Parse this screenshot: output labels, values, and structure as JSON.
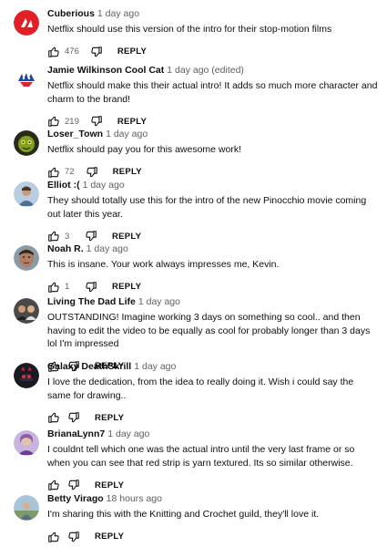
{
  "comments": [
    {
      "author": "Cuberious",
      "time": "1 day ago",
      "text": "Netflix should use this version of the intro for their stop-motion films",
      "likes": "476",
      "reply": "REPLY",
      "avatar_icon": "cuberious-logo-avatar",
      "accent": "#e01f26"
    },
    {
      "author": "Jamie Wilkinson Cool Cat",
      "time": "1 day ago (edited)",
      "text": "Netflix should make this their actual intro! It adds so much more character and charm to the brand!",
      "likes": "219",
      "reply": "REPLY",
      "avatar_icon": "cat-drawing-avatar",
      "accent": "#2244aa"
    },
    {
      "author": "Loser_Town",
      "time": "1 day ago",
      "text": "Netflix should pay you for this awesome work!",
      "likes": "72",
      "reply": "REPLY",
      "avatar_icon": "green-character-avatar",
      "accent": "#6a8a1a"
    },
    {
      "author": "Elliot :(",
      "time": "1 day ago",
      "text": "They should totally use this for the intro of the new Pinocchio movie coming out later this year.",
      "likes": "3",
      "reply": "REPLY",
      "avatar_icon": "person-photo-avatar",
      "accent": "#6b8cae"
    },
    {
      "author": "Noah R.",
      "time": "1 day ago",
      "text": "This is insane. Your work always impresses me, Kevin.",
      "likes": "1",
      "reply": "REPLY",
      "avatar_icon": "face-photo-avatar",
      "accent": "#7a5a48"
    },
    {
      "author": "Living The Dad Life",
      "time": "1 day ago",
      "text": "OUTSTANDING! Imagine working 3 days on something so cool.. and then having to edit the video to be equally as cool for probably longer than 3 days lol I'm impressed",
      "likes": "",
      "reply": "REPLY",
      "avatar_icon": "group-photo-avatar",
      "accent": "#3a3a3a"
    },
    {
      "author": "Galaxy DeathSkrill",
      "time": "1 day ago",
      "text": "I love the dedication, from the idea to really doing it. Wish i could say the same for drawing..",
      "likes": "",
      "reply": "REPLY",
      "avatar_icon": "dark-character-avatar",
      "accent": "#c8263a"
    },
    {
      "author": "BrianaLynn7",
      "time": "1 day ago",
      "text": "I couldnt tell which one was the actual intro until the very last frame or so when you can see that red strip is yarn textured. Its so similar otherwise.",
      "likes": "",
      "reply": "REPLY",
      "avatar_icon": "purple-portrait-avatar",
      "accent": "#9a6ab8"
    },
    {
      "author": "Betty Virago",
      "time": "18 hours ago",
      "text": "I'm sharing this with the Knitting and Crochet guild, they'll love it.",
      "likes": "",
      "reply": "REPLY",
      "avatar_icon": "outdoor-photo-avatar",
      "accent": "#8fb0c8"
    }
  ]
}
